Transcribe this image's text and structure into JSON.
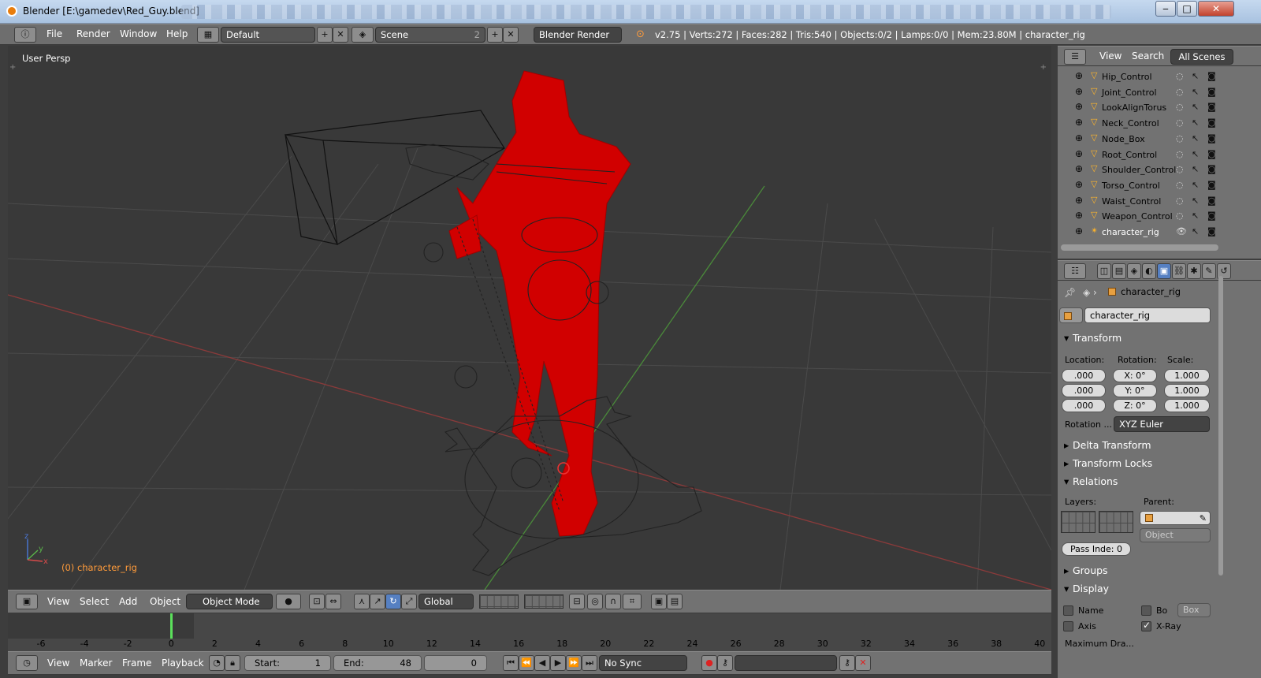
{
  "window": {
    "title": "Blender [E:\\gamedev\\Red_Guy.blend]",
    "minimize": "‒",
    "maximize": "□",
    "close": "✕"
  },
  "topbar": {
    "menus": [
      "File",
      "Render",
      "Window",
      "Help"
    ],
    "screen_layout": "Default",
    "scene": "Scene",
    "scene_users": "2",
    "engine": "Blender Render",
    "stats": "v2.75 | Verts:272 | Faces:282 | Tris:540 | Objects:0/2 | Lamps:0/0 | Mem:23.80M | character_rig"
  },
  "viewport": {
    "view_label": "User Persp",
    "object_label": "(0) character_rig",
    "header_menus": [
      "View",
      "Select",
      "Add",
      "Object"
    ],
    "mode": "Object Mode",
    "orientation": "Global"
  },
  "timeline": {
    "ticks": [
      "-6",
      "-4",
      "-2",
      "0",
      "2",
      "4",
      "6",
      "8",
      "10",
      "12",
      "14",
      "16",
      "18",
      "20",
      "22",
      "24",
      "26",
      "28",
      "30",
      "32",
      "34",
      "36",
      "38",
      "40"
    ],
    "menus": [
      "View",
      "Marker",
      "Frame",
      "Playback"
    ],
    "start_label": "Start:",
    "start": "1",
    "end_label": "End:",
    "end": "48",
    "current": "0",
    "sync": "No Sync"
  },
  "outliner": {
    "menus": [
      "View",
      "Search"
    ],
    "scope": "All Scenes",
    "items": [
      "Hip_Control",
      "Joint_Control",
      "LookAlignTorus",
      "Neck_Control",
      "Node_Box",
      "Root_Control",
      "Shoulder_Control",
      "Torso_Control",
      "Waist_Control",
      "Weapon_Control",
      "character_rig"
    ]
  },
  "properties": {
    "breadcrumb": "character_rig",
    "object_name": "character_rig",
    "transform": {
      "header": "Transform",
      "location_label": "Location:",
      "rotation_label": "Rotation:",
      "scale_label": "Scale:",
      "location": [
        ".000",
        ".000",
        ".000"
      ],
      "rotation": [
        "X:  0°",
        "Y:  0°",
        "Z:  0°"
      ],
      "scale": [
        "1.000",
        "1.000",
        "1.000"
      ],
      "rotation_mode_label": "Rotation ...",
      "rotation_mode": "XYZ Euler"
    },
    "delta_transform": "Delta Transform",
    "transform_locks": "Transform Locks",
    "relations": {
      "header": "Relations",
      "layers_label": "Layers:",
      "parent_label": "Parent:",
      "parent_type": "Object",
      "pass_index": "Pass Inde:  0"
    },
    "groups": "Groups",
    "display": {
      "header": "Display",
      "name": "Name",
      "bounds": "Bo",
      "bounds_type": "Box",
      "axis": "Axis",
      "xray": "X-Ray",
      "max_draw": "Maximum Dra..."
    }
  }
}
